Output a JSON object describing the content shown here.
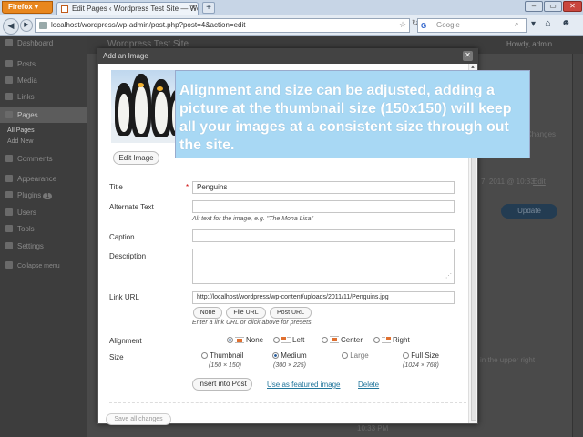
{
  "browser": {
    "menu_label": "Firefox",
    "tab_title": "Edit Pages ‹ Wordpress Test Site — Word...",
    "url": "localhost/wordpress/wp-admin/post.php?post=4&action=edit",
    "search_placeholder": "Google",
    "search_engine_icon": "G"
  },
  "wp": {
    "site_title": "Wordpress Test Site",
    "howdy": "Howdy, admin",
    "menu": [
      {
        "label": "Dashboard",
        "icon": "dashboard-icon"
      },
      {
        "label": "Posts",
        "icon": "posts-icon"
      },
      {
        "label": "Media",
        "icon": "media-icon"
      },
      {
        "label": "Links",
        "icon": "links-icon"
      },
      {
        "label": "Pages",
        "icon": "pages-icon"
      },
      {
        "label": "Comments",
        "icon": "comments-icon"
      },
      {
        "label": "Appearance",
        "icon": "appearance-icon"
      },
      {
        "label": "Plugins",
        "icon": "plugins-icon",
        "badge": "1"
      },
      {
        "label": "Users",
        "icon": "users-icon"
      },
      {
        "label": "Tools",
        "icon": "tools-icon"
      },
      {
        "label": "Settings",
        "icon": "settings-icon"
      },
      {
        "label": "Collapse menu",
        "icon": "collapse-icon"
      }
    ],
    "pages_sub": [
      "All Pages",
      "Add New"
    ],
    "bg_changes": "Changes",
    "bg_date": "7, 2011 @ 10:33",
    "bg_edit": "Edit",
    "bg_update": "Update",
    "bg_time": "10:33 PM",
    "bg_upper_right": "in the upper right"
  },
  "modal": {
    "title": "Add an Image",
    "edit_image_label": "Edit Image",
    "callout": "Alignment and size can be adjusted, adding a picture at the thumbnail size (150x150) will keep all your images at a consistent size through out the site.",
    "fields": {
      "title_label": "Title",
      "title_required": "*",
      "title_value": "Penguins",
      "alt_label": "Alternate Text",
      "alt_help": "Alt text for the image, e.g. \"The Mona Lisa\"",
      "caption_label": "Caption",
      "description_label": "Description",
      "link_label": "Link URL",
      "link_value": "http://localhost/wordpress/wp-content/uploads/2011/11/Penguins.jpg",
      "link_help": "Enter a link URL or click above for presets.",
      "link_buttons": [
        "None",
        "File URL",
        "Post URL"
      ]
    },
    "alignment": {
      "label": "Alignment",
      "options": [
        "None",
        "Left",
        "Center",
        "Right"
      ],
      "selected": "None"
    },
    "size": {
      "label": "Size",
      "options": [
        {
          "name": "Thumbnail",
          "dims": "(150 × 150)"
        },
        {
          "name": "Medium",
          "dims": "(300 × 225)"
        },
        {
          "name": "Large",
          "dims": ""
        },
        {
          "name": "Full Size",
          "dims": "(1024 × 768)"
        }
      ],
      "selected": "Medium"
    },
    "insert_label": "Insert into Post",
    "featured_label": "Use as featured image",
    "delete_label": "Delete",
    "save_all_label": "Save all changes"
  },
  "colors": {
    "callout_bg": "#a8d8f4",
    "callout_text": "#ffffff",
    "firefox_orange": "#e8871f",
    "link_blue": "#21759b"
  }
}
